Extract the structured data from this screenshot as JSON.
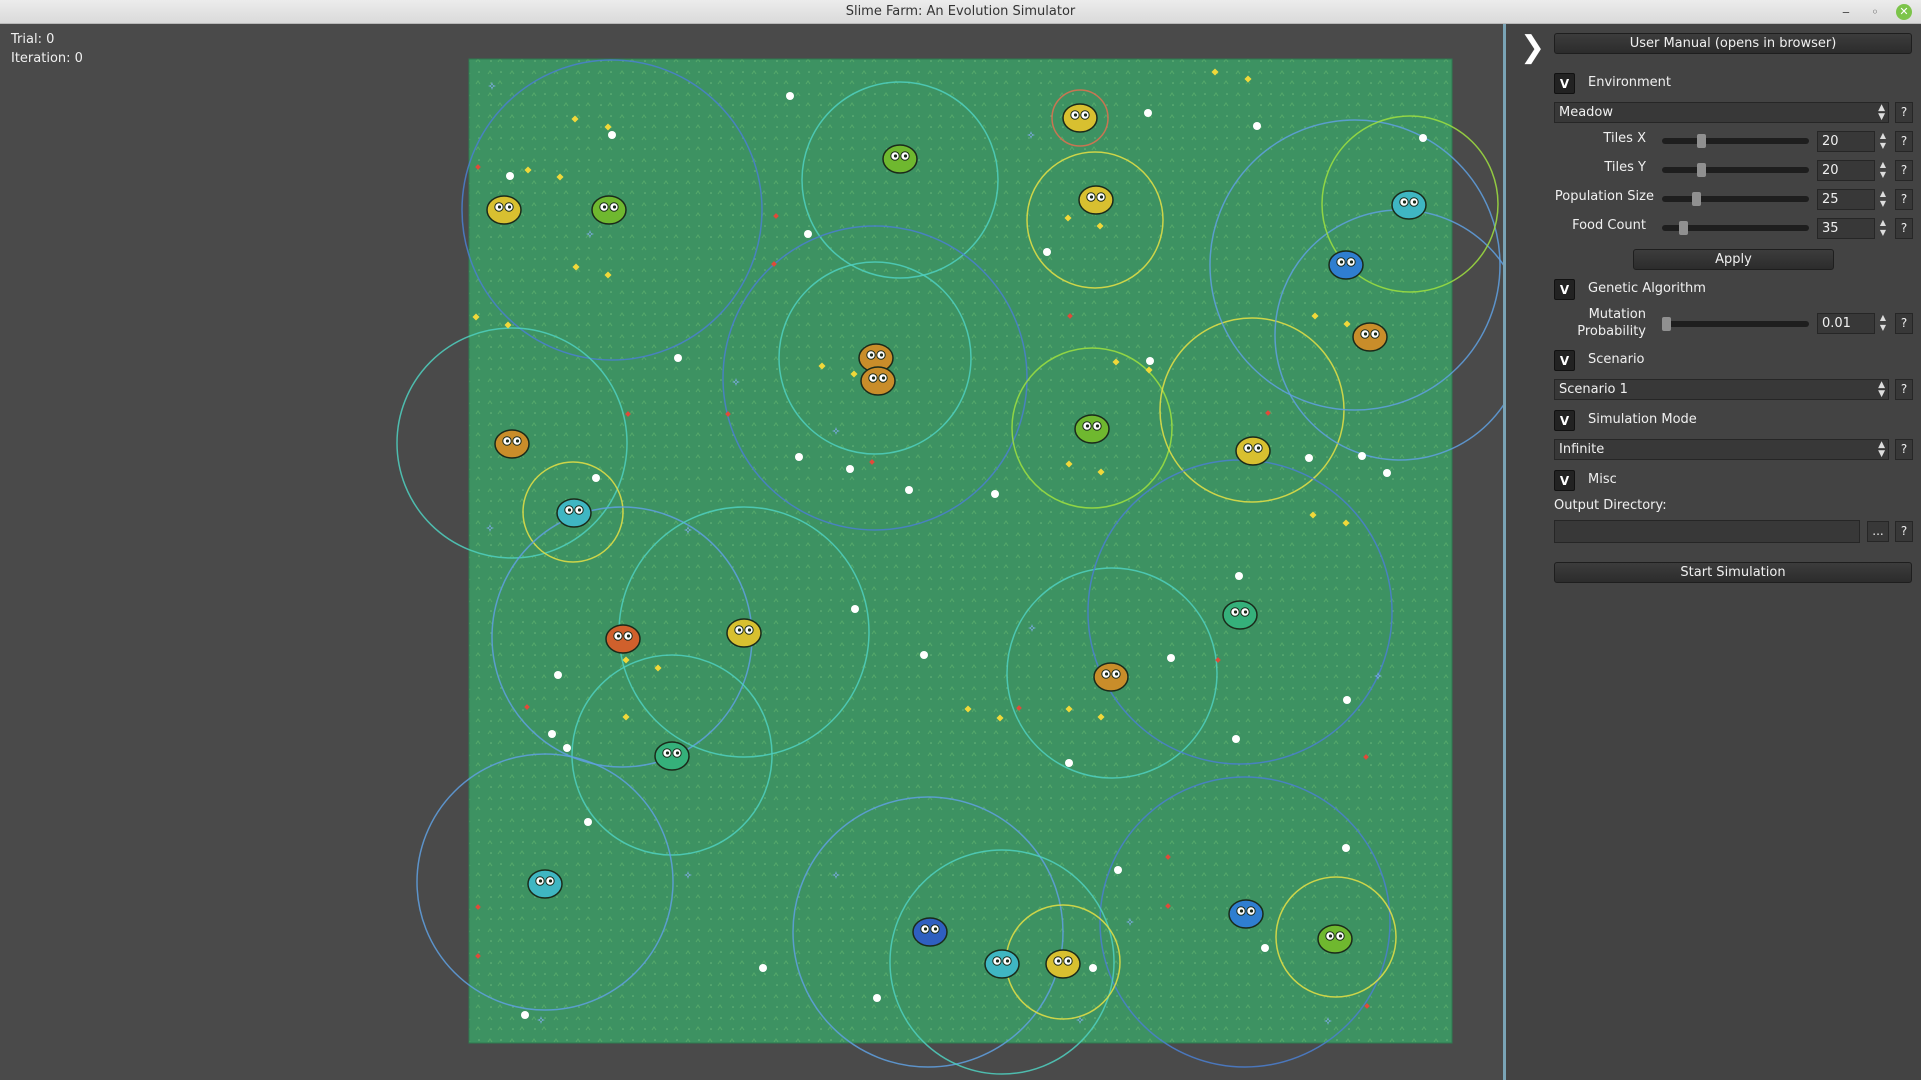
{
  "window": {
    "title": "Slime Farm: An Evolution Simulator",
    "minimize_glyph": "‒",
    "maximize_glyph": "◦",
    "close_glyph": "✕"
  },
  "stats": {
    "trial": "Trial: 0",
    "iteration": "Iteration: 0"
  },
  "world": {
    "environment": "meadow",
    "ground_color": "#3d9262",
    "border_color": "#2f7a50",
    "food_color": "#ffffff",
    "slime_colors": [
      "#6fb82f",
      "#d8c030",
      "#c98d2a",
      "#3fb6c2",
      "#2f7ed0",
      "#d0602c",
      "#35b07a",
      "#2f5fc0"
    ],
    "ring_colors": [
      "#4a7fd0",
      "#4fd0c0",
      "#e6e045",
      "#9fe040",
      "#e07050",
      "#5fa0e0"
    ]
  },
  "panel": {
    "toggle_glyph": "❯",
    "user_manual_label": "User Manual (opens in browser)",
    "sections": {
      "environment": {
        "toggle": "V",
        "label": "Environment"
      },
      "genetic_algorithm": {
        "toggle": "V",
        "label": "Genetic Algorithm"
      },
      "scenario": {
        "toggle": "V",
        "label": "Scenario"
      },
      "simulation_mode": {
        "toggle": "V",
        "label": "Simulation Mode"
      },
      "misc": {
        "toggle": "V",
        "label": "Misc"
      }
    },
    "environment_select": "Meadow",
    "tiles_x": {
      "label": "Tiles X",
      "value": "20",
      "fraction": 0.25
    },
    "tiles_y": {
      "label": "Tiles Y",
      "value": "20",
      "fraction": 0.25
    },
    "population_size": {
      "label": "Population Size",
      "value": "25",
      "fraction": 0.22
    },
    "food_count": {
      "label": "Food Count",
      "value": "35",
      "fraction": 0.12
    },
    "apply_label": "Apply",
    "mutation_label_line1": "Mutation",
    "mutation_label_line2": "Probability",
    "mutation_probability": {
      "value": "0.01",
      "fraction": 0.0
    },
    "scenario_select": "Scenario 1",
    "simulation_mode_select": "Infinite",
    "output_directory_label": "Output Directory:",
    "output_directory_value": "",
    "browse_label": "...",
    "help_glyph": "?",
    "start_simulation_label": "Start Simulation"
  }
}
